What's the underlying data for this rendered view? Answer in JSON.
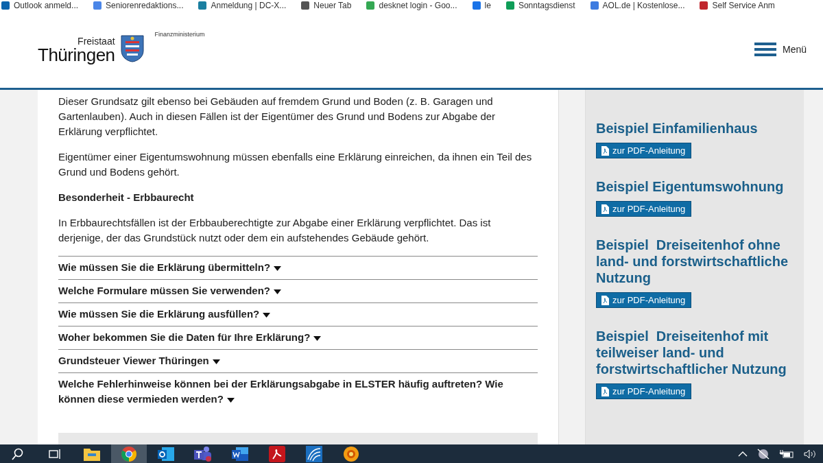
{
  "bookmarks": [
    {
      "label": "Outlook anmeld...",
      "color": "#0a64ad"
    },
    {
      "label": "Seniorenredaktions...",
      "color": "#4a86e8"
    },
    {
      "label": "Anmeldung | DC-X...",
      "color": "#1a7fa0"
    },
    {
      "label": "Neuer Tab",
      "color": "#555555"
    },
    {
      "label": "desknet login - Goo...",
      "color": "#34a853"
    },
    {
      "label": "le",
      "color": "#1a73e8"
    },
    {
      "label": "Sonntagsdienst",
      "color": "#0f9d58"
    },
    {
      "label": "AOL.de | Kostenlose...",
      "color": "#3d7be0"
    },
    {
      "label": "Self Service Anm",
      "color": "#c0262d"
    }
  ],
  "header": {
    "logo_small": "Freistaat",
    "logo_large": "Thüringen",
    "ministry": "Finanzministerium",
    "menu_label": "Menü"
  },
  "article": {
    "paragraphs": [
      {
        "kind": "text",
        "text": "Dieser Grundsatz gilt ebenso bei Gebäuden auf fremdem Grund und Boden (z. B. Garagen und Gartenlauben). Auch in diesen Fällen ist der Eigentümer des Grund und Bodens zur Abgabe der Erklärung verpflichtet."
      },
      {
        "kind": "text",
        "text": "Eigentümer einer Eigentumswohnung müssen ebenfalls eine Erklärung einreichen, da ihnen ein Teil des Grund und Bodens gehört."
      },
      {
        "kind": "heading",
        "text": "Besonderheit - Erbbaurecht"
      },
      {
        "kind": "text",
        "text": "In Erbbaurechtsfällen ist der Erbbauberechtigte zur Abgabe einer Erklärung verpflichtet. Das ist derjenige, der das Grundstück nutzt oder dem ein aufstehendes Gebäude gehört."
      }
    ],
    "accordion": [
      {
        "title": "Wie müssen Sie die Erklärung übermitteln?",
        "expanded": false
      },
      {
        "title": "Welche Formulare müssen Sie verwenden?",
        "expanded": false
      },
      {
        "title": "Wie müssen Sie die Erklärung ausfüllen?",
        "expanded": false
      },
      {
        "title": "Woher bekommen Sie die Daten für Ihre Erklärung?",
        "expanded": false
      },
      {
        "title": "Grundsteuer Viewer Thüringen",
        "expanded": false
      },
      {
        "title": "Welche Fehlerhinweise können bei der Erklärungsabgabe in ELSTER häufig auftreten? Wie können diese vermieden werden?",
        "expanded": false
      }
    ]
  },
  "sidebar": {
    "items": [
      {
        "title": "Beispiel Einfamilienhaus",
        "button": "zur PDF-Anleitung"
      },
      {
        "title": "Beispiel Eigentumswohnung",
        "button": "zur PDF-Anleitung"
      },
      {
        "title": "Beispiel  Dreiseitenhof ohne land- und forstwirtschaftliche Nutzung",
        "button": "zur PDF-Anleitung"
      },
      {
        "title": "Beispiel  Dreiseitenhof mit teilweiser land- und forstwirtschaftlicher Nutzung",
        "button": "zur PDF-Anleitung"
      }
    ]
  },
  "taskbar": {
    "apps": [
      {
        "kind": "search",
        "selected": false
      },
      {
        "kind": "taskview",
        "selected": false
      },
      {
        "kind": "folder",
        "selected": false
      },
      {
        "kind": "browser",
        "selected": true
      },
      {
        "kind": "mail",
        "selected": false
      },
      {
        "kind": "teams",
        "selected": false
      },
      {
        "kind": "word",
        "selected": false
      },
      {
        "kind": "pdf",
        "selected": false
      },
      {
        "kind": "network",
        "selected": false
      },
      {
        "kind": "sun",
        "selected": false
      }
    ]
  }
}
